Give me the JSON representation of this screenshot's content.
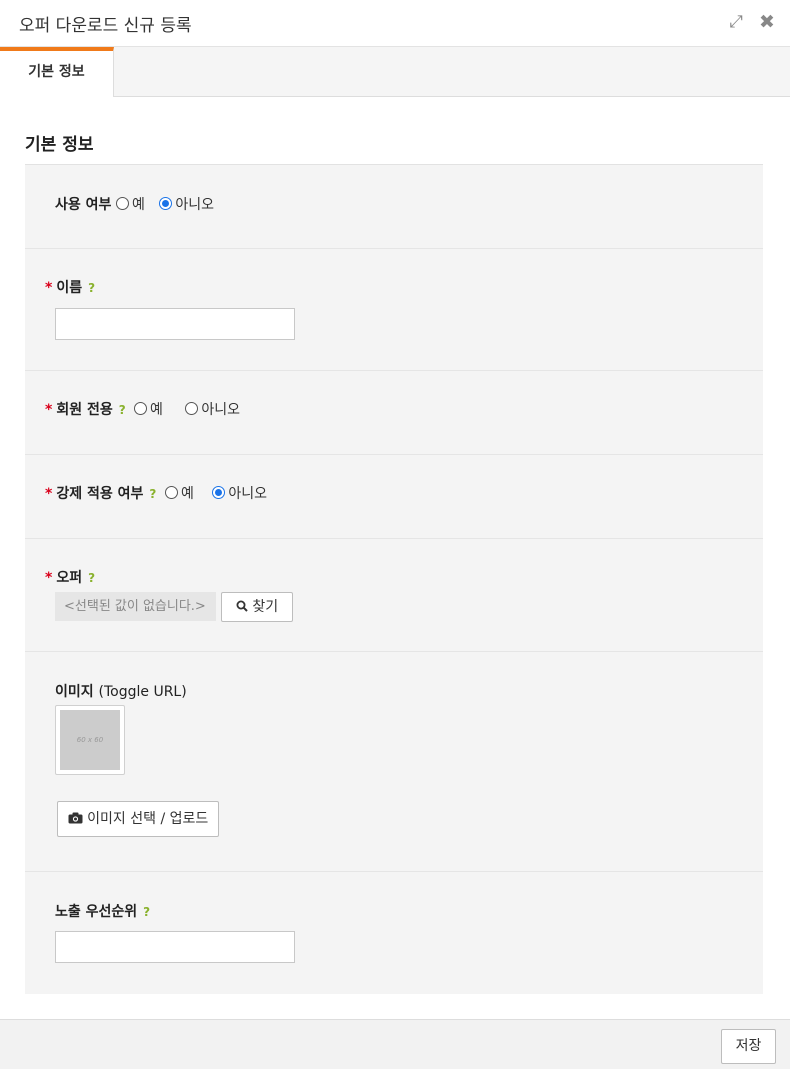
{
  "window": {
    "title": "오퍼 다운로드 신규 등록",
    "expand_icon": "expand-icon",
    "close_icon": "close-icon"
  },
  "tabs": [
    {
      "label": "기본 정보",
      "active": true
    }
  ],
  "section": {
    "title": "기본 정보"
  },
  "form": {
    "use": {
      "label": "사용 여부",
      "options": [
        "예",
        "아니오"
      ],
      "selected": "아니오"
    },
    "name": {
      "required_mark": "*",
      "label": "이름",
      "help": "?",
      "value": ""
    },
    "members_only": {
      "required_mark": "*",
      "label": "회원 전용",
      "help": "?",
      "options": [
        "예",
        "아니오"
      ],
      "selected": ""
    },
    "force_apply": {
      "required_mark": "*",
      "label": "강제 적용 여부",
      "help": "?",
      "options": [
        "예",
        "아니오"
      ],
      "selected": "아니오"
    },
    "offer": {
      "required_mark": "*",
      "label": "오퍼",
      "help": "?",
      "empty_text": "<선택된 값이 없습니다.>",
      "find_label": "찾기"
    },
    "image": {
      "label": "이미지",
      "sub_label": "(Toggle URL)",
      "placeholder_text": "60 x 60",
      "upload_label": "이미지 선택 / 업로드"
    },
    "priority": {
      "label": "노출 우선순위",
      "help": "?",
      "value": ""
    }
  },
  "footer": {
    "save_label": "저장"
  },
  "colors": {
    "tab_accent": "#f07a1a",
    "required": "#d9001b",
    "help": "#8ab22e",
    "radio_checked": "#1a73e8"
  }
}
